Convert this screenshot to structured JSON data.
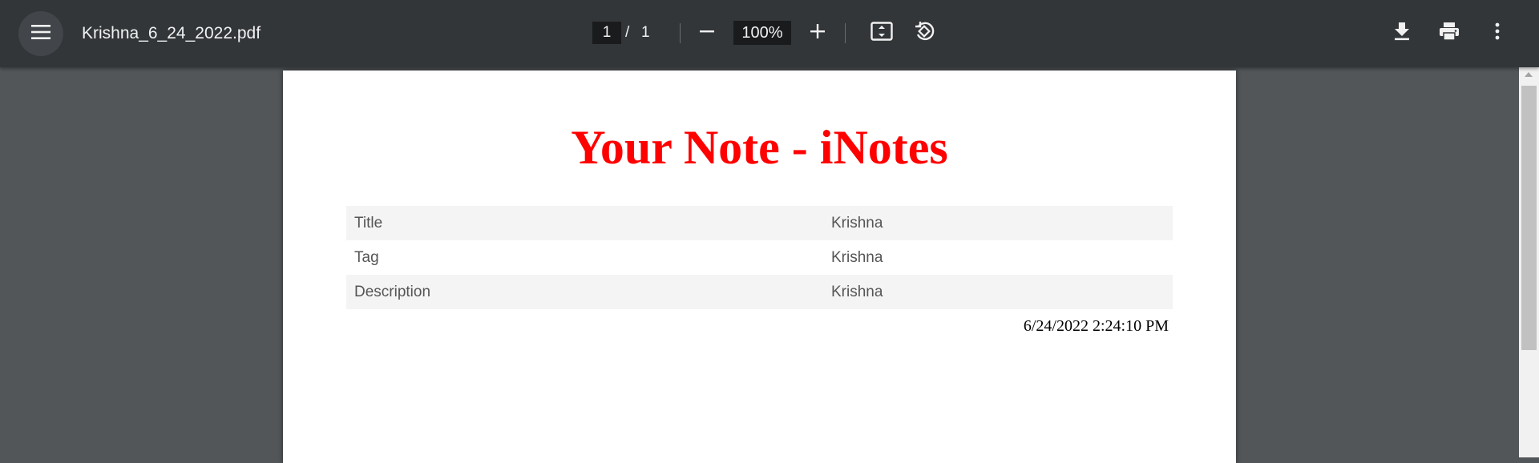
{
  "toolbar": {
    "menu_icon": "hamburger-menu-icon",
    "file_name": "Krishna_6_24_2022.pdf",
    "current_page": "1",
    "page_separator": "/",
    "total_pages": "1",
    "zoom_out_icon": "minus-icon",
    "zoom_level": "100%",
    "zoom_in_icon": "plus-icon",
    "fit_page_icon": "fit-to-page-icon",
    "rotate_icon": "rotate-counterclockwise-icon",
    "download_icon": "download-icon",
    "print_icon": "print-icon",
    "more_icon": "more-vertical-icon"
  },
  "document": {
    "title": "Your Note - iNotes",
    "title_color": "#ff0000",
    "rows": [
      {
        "label": "Title",
        "value": "Krishna"
      },
      {
        "label": "Tag",
        "value": "Krishna"
      },
      {
        "label": "Description",
        "value": "Krishna"
      }
    ],
    "timestamp": "6/24/2022 2:24:10 PM"
  }
}
